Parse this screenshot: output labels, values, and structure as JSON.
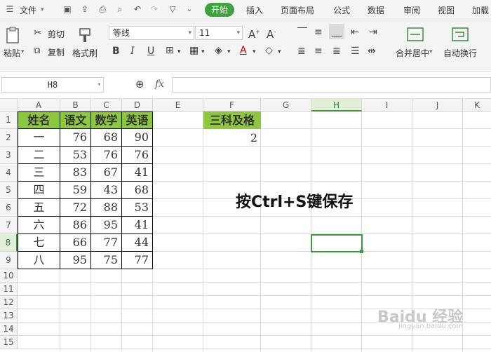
{
  "menubar": {
    "file_label": "文件",
    "tabs": [
      "开始",
      "插入",
      "页面布局",
      "公式",
      "数据",
      "审阅",
      "视图",
      "加载"
    ]
  },
  "ribbon": {
    "paste_label": "粘贴",
    "cut_label": "剪切",
    "copy_label": "复制",
    "format_painter_label": "格式刷",
    "font_name": "等线",
    "font_size": "11",
    "merge_center_label": "合并居中",
    "wrap_text_label": "自动换行"
  },
  "formula_bar": {
    "name_box": "H8",
    "fx_label": "fx",
    "formula": ""
  },
  "columns": [
    "A",
    "B",
    "C",
    "D",
    "E",
    "F",
    "G",
    "H",
    "I",
    "J",
    "K"
  ],
  "rows": [
    "1",
    "2",
    "3",
    "4",
    "5",
    "6",
    "7",
    "8",
    "9",
    "10",
    "11",
    "12",
    "13",
    "14",
    "15"
  ],
  "table": {
    "headers": [
      "姓名",
      "语文",
      "数学",
      "英语"
    ],
    "rows": [
      [
        "一",
        "76",
        "68",
        "90"
      ],
      [
        "二",
        "53",
        "76",
        "76"
      ],
      [
        "三",
        "83",
        "67",
        "41"
      ],
      [
        "四",
        "59",
        "43",
        "68"
      ],
      [
        "五",
        "72",
        "88",
        "53"
      ],
      [
        "六",
        "86",
        "95",
        "41"
      ],
      [
        "七",
        "66",
        "77",
        "44"
      ],
      [
        "八",
        "95",
        "75",
        "77"
      ]
    ]
  },
  "result": {
    "header": "三科及格",
    "value": "2"
  },
  "annotation": "按Ctrl+S键保存",
  "watermark": {
    "main": "Baidu 经验",
    "sub": "jingyan.baidu.com"
  },
  "colors": {
    "accent": "#3fa33f",
    "header_fill": "#8dc63f",
    "selection": "#3b9a3b"
  },
  "selected_cell": "H8"
}
